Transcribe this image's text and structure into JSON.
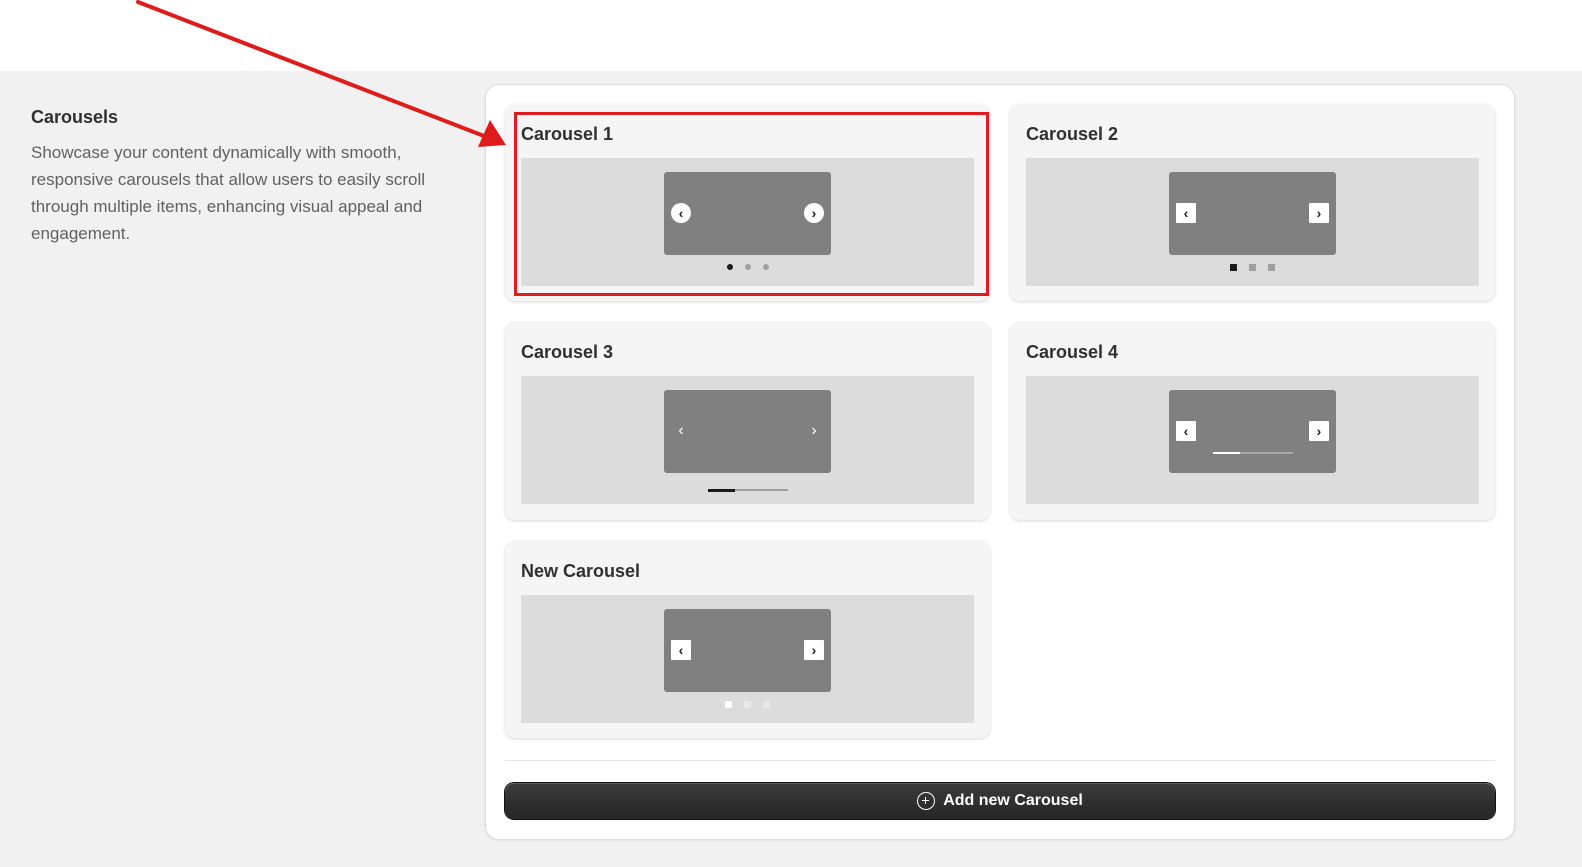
{
  "section": {
    "title": "Carousels",
    "description": "Showcase your content dynamically with smooth, responsive carousels that allow users to easily scroll through multiple items, enhancing visual appeal and engagement."
  },
  "carousels": [
    {
      "title": "Carousel 1",
      "arrow_style": "round",
      "indicator": "dots",
      "selected": true
    },
    {
      "title": "Carousel 2",
      "arrow_style": "square",
      "indicator": "square-dots",
      "selected": false
    },
    {
      "title": "Carousel 3",
      "arrow_style": "bare",
      "indicator": "scrollbar",
      "selected": false
    },
    {
      "title": "Carousel 4",
      "arrow_style": "square",
      "indicator": "inner-scrollbar",
      "selected": false
    },
    {
      "title": "New Carousel",
      "arrow_style": "square",
      "indicator": "light-dots",
      "selected": false
    }
  ],
  "add_button": {
    "label": "Add new Carousel",
    "icon": "plus-circle-icon"
  },
  "annotation": {
    "color": "#e01b1b",
    "target": "Carousel 1"
  }
}
